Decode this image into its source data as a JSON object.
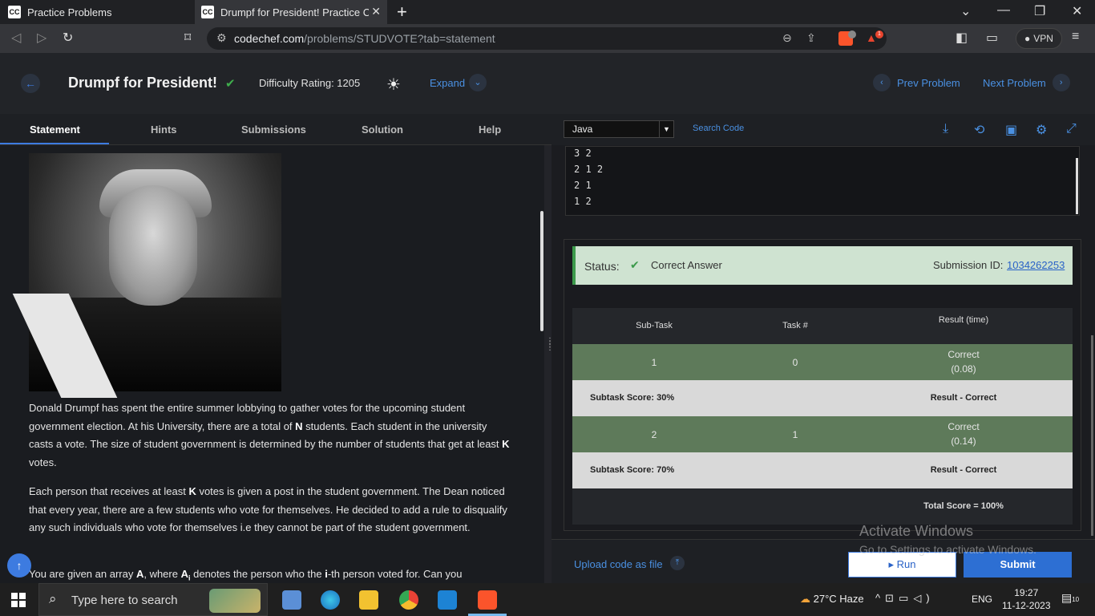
{
  "browser": {
    "tab1_title": "Practice Problems",
    "tab2_title": "Drumpf for President! Practice Co",
    "tab_favicon": "CC",
    "url_domain": "codechef.com",
    "url_path": "/problems/STUDVOTE?tab=statement",
    "vpn_label": "VPN",
    "brave_badge": "1"
  },
  "header": {
    "title": "Drumpf for President!",
    "difficulty": "Difficulty Rating: 1205",
    "expand_label": "Expand",
    "prev_label": "Prev Problem",
    "next_label": "Next Problem"
  },
  "problem_tabs": [
    "Statement",
    "Hints",
    "Submissions",
    "Solution",
    "Help"
  ],
  "statement": {
    "p1": "Donald Drumpf has spent the entire summer lobbying to gather votes for the upcoming student government election. At his University, there are a total of N students. Each student in the university casts a vote. The size of student government is determined by the number of students that get at least K votes.",
    "p2": "Each person that receives at least K votes is given a post in the student government. The Dean noticed that every year, there are a few students who vote for themselves. He decided to add a rule to disqualify any such individuals who vote for themselves i.e they cannot be part of the student government.",
    "p3": "You are given an array A, where Ai denotes the person who the i-th person voted for. Can you"
  },
  "editor": {
    "language": "Java",
    "search_code": "Search Code",
    "output_lines": [
      "3 2",
      "2 1 2",
      "2 1",
      "1 2"
    ]
  },
  "result": {
    "status_label": "Status:",
    "status_value": "Correct Answer",
    "submission_id_label": "Submission ID:",
    "submission_id": "1034262253",
    "headers": [
      "Sub-Task",
      "Task #",
      "Result (time)"
    ],
    "rows": [
      {
        "subtask": "1",
        "task": "0",
        "result": "Correct",
        "time": "(0.08)"
      },
      {
        "subtask": "2",
        "task": "1",
        "result": "Correct",
        "time": "(0.14)"
      }
    ],
    "subtask_scores": [
      "Subtask Score: 30%",
      "Subtask Score: 70%"
    ],
    "subtask_results": [
      "Result - Correct",
      "Result - Correct"
    ],
    "total_score": "Total Score = 100%"
  },
  "footer": {
    "upload_label": "Upload code as file",
    "run_label": "Run",
    "submit_label": "Submit"
  },
  "watermark": {
    "line1": "Activate Windows",
    "line2": "Go to Settings to activate Windows."
  },
  "taskbar": {
    "search_placeholder": "Type here to search",
    "weather": "27°C  Haze",
    "lang": "ENG",
    "time": "19:27",
    "date": "11-12-2023",
    "notif_count": "10"
  },
  "colors": {
    "accent": "#3d7be0",
    "success": "#3c9a4b",
    "correct_row": "#5e7a5a",
    "score_row": "#d9d9d9"
  }
}
